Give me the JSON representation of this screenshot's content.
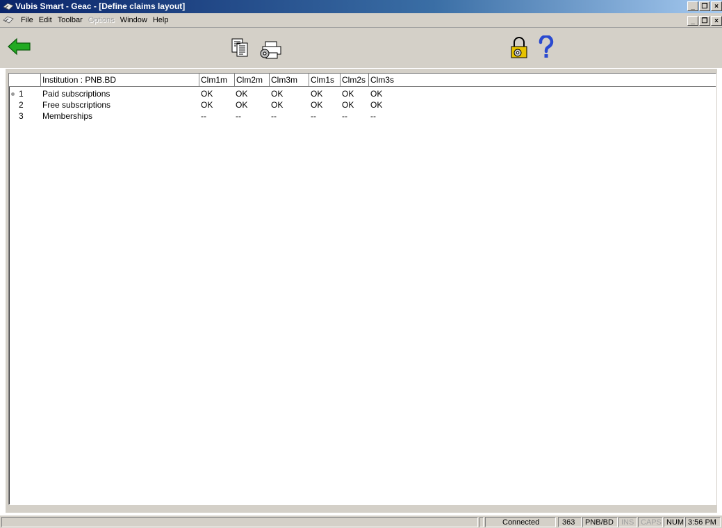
{
  "window": {
    "title": "Vubis Smart - Geac - [Define claims layout]"
  },
  "menubar": {
    "items": [
      "File",
      "Edit",
      "Toolbar",
      "Options",
      "Window",
      "Help"
    ],
    "disabled": [
      "Options"
    ]
  },
  "toolbar": {
    "back_icon": "arrow-left-icon",
    "copy_icon": "document-copy-icon",
    "print_setup_icon": "printer-settings-icon",
    "lock_icon": "lock-settings-icon",
    "help_icon": "help-question-icon",
    "colors": {
      "back_arrow": "#22aa22",
      "help": "#2a4ad0",
      "lock": "#e6c200"
    }
  },
  "grid": {
    "columns": [
      "Institution : PNB.BD",
      "Clm1m",
      "Clm2m",
      "Clm3m",
      "Clm1s",
      "Clm2s",
      "Clm3s"
    ],
    "rows": [
      {
        "num": "1",
        "name": "Paid subscriptions",
        "values": [
          "OK",
          "OK",
          "OK",
          "OK",
          "OK",
          "OK"
        ]
      },
      {
        "num": "2",
        "name": "Free subscriptions",
        "values": [
          "OK",
          "OK",
          "OK",
          "OK",
          "OK",
          "OK"
        ]
      },
      {
        "num": "3",
        "name": "Memberships",
        "values": [
          "--",
          "--",
          "--",
          "--",
          "--",
          "--"
        ]
      }
    ]
  },
  "statusbar": {
    "connection": "Connected",
    "count": "363",
    "location": "PNB/BD",
    "ins": "INS",
    "caps": "CAPS",
    "num": "NUM",
    "time": "3:56 PM"
  }
}
